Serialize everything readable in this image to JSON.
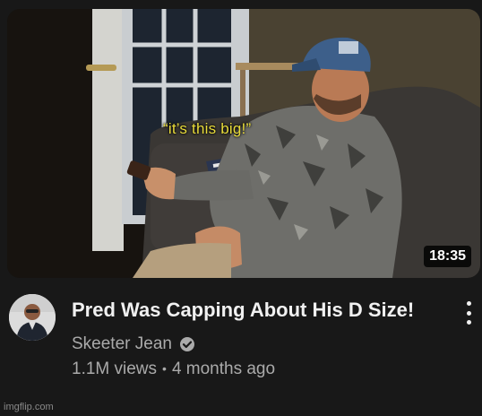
{
  "video": {
    "caption": "“it’s this big!”",
    "duration": "18:35",
    "title": "Pred Was Capping About His D Size!",
    "channel": "Skeeter Jean",
    "views": "1.1M views",
    "separator": "•",
    "age": "4 months ago"
  },
  "icons": {
    "verified": "check-circle-icon",
    "more": "three-dots-vertical-icon"
  },
  "watermark": "imgflip.com",
  "colors": {
    "background": "#181818",
    "title": "#f1f1f1",
    "meta": "#aaaaaa",
    "caption": "#e9dc3b"
  }
}
